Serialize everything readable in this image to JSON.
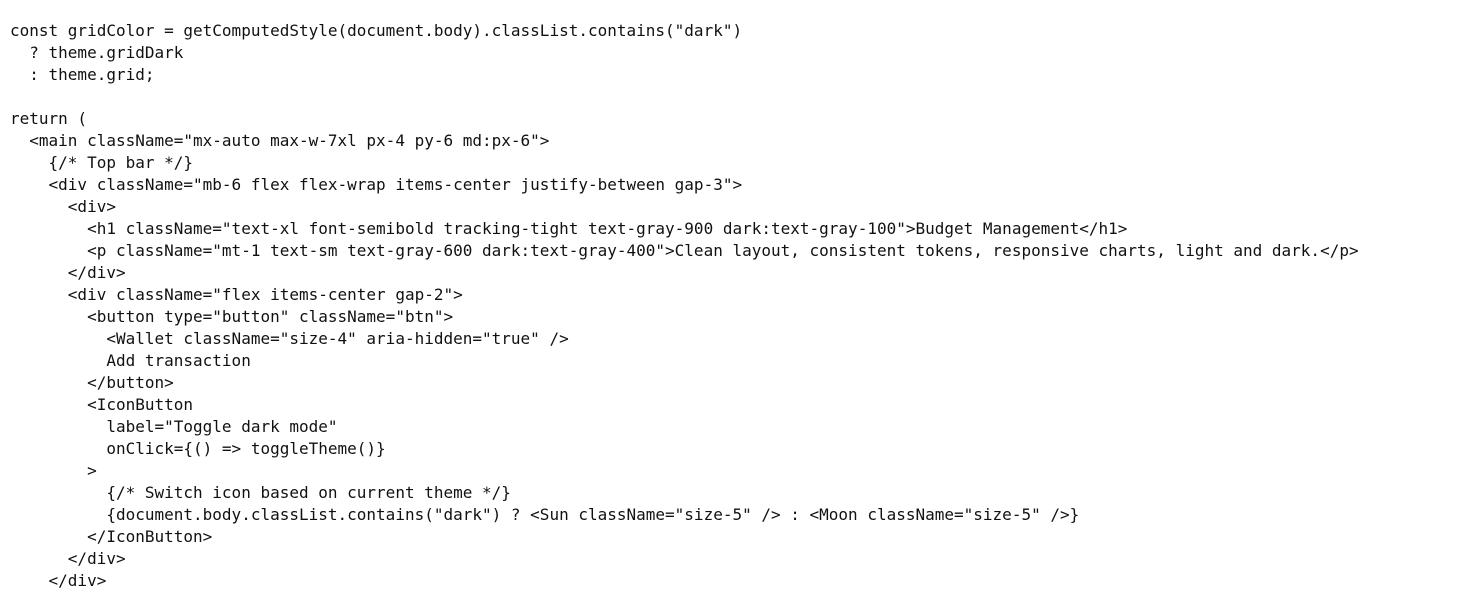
{
  "code": {
    "lines": [
      "const gridColor = getComputedStyle(document.body).classList.contains(\"dark\")",
      "  ? theme.gridDark",
      "  : theme.grid;",
      "",
      "return (",
      "  <main className=\"mx-auto max-w-7xl px-4 py-6 md:px-6\">",
      "    {/* Top bar */}",
      "    <div className=\"mb-6 flex flex-wrap items-center justify-between gap-3\">",
      "      <div>",
      "        <h1 className=\"text-xl font-semibold tracking-tight text-gray-900 dark:text-gray-100\">Budget Management</h1>",
      "        <p className=\"mt-1 text-sm text-gray-600 dark:text-gray-400\">Clean layout, consistent tokens, responsive charts, light and dark.</p>",
      "      </div>",
      "      <div className=\"flex items-center gap-2\">",
      "        <button type=\"button\" className=\"btn\">",
      "          <Wallet className=\"size-4\" aria-hidden=\"true\" />",
      "          Add transaction",
      "        </button>",
      "        <IconButton",
      "          label=\"Toggle dark mode\"",
      "          onClick={() => toggleTheme()}",
      "        >",
      "          {/* Switch icon based on current theme */}",
      "          {document.body.classList.contains(\"dark\") ? <Sun className=\"size-5\" /> : <Moon className=\"size-5\" />}",
      "        </IconButton>",
      "      </div>",
      "    </div>"
    ]
  }
}
